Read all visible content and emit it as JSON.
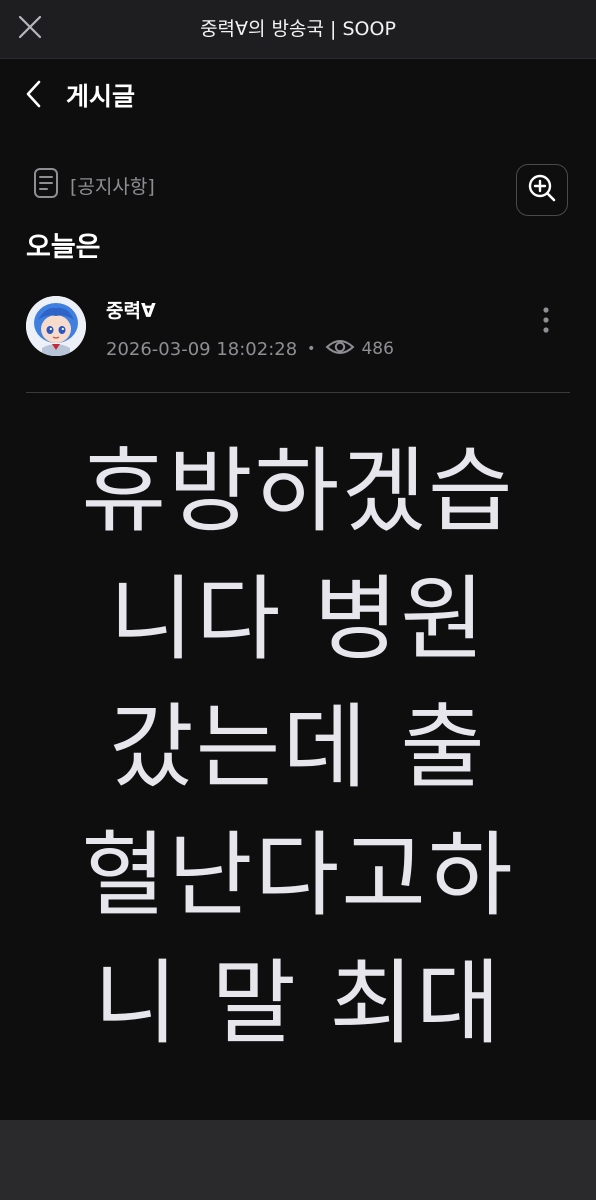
{
  "header": {
    "title": "중력∀의 방송국 | SOOP"
  },
  "nav": {
    "title": "게시글"
  },
  "post": {
    "category": "[공지사항]",
    "title": "오늘은",
    "author": "중력∀",
    "datetime": "2026-03-09 18:02:28",
    "separator": "•",
    "views": "486",
    "body_lines": [
      "휴방하겠습",
      "니다 병원",
      "갔는데 출",
      "혈난다고하",
      "니 말 최대"
    ]
  },
  "icons": {
    "close": "close-icon",
    "back": "chevron-left-icon",
    "category": "document-icon",
    "zoom": "zoom-in-icon",
    "views": "eye-icon",
    "more": "more-vertical-icon"
  },
  "colors": {
    "background": "#0e0e0f",
    "topbar": "#1e1e20",
    "muted_text": "#8e8e93",
    "body_text": "#e6e6ec"
  }
}
